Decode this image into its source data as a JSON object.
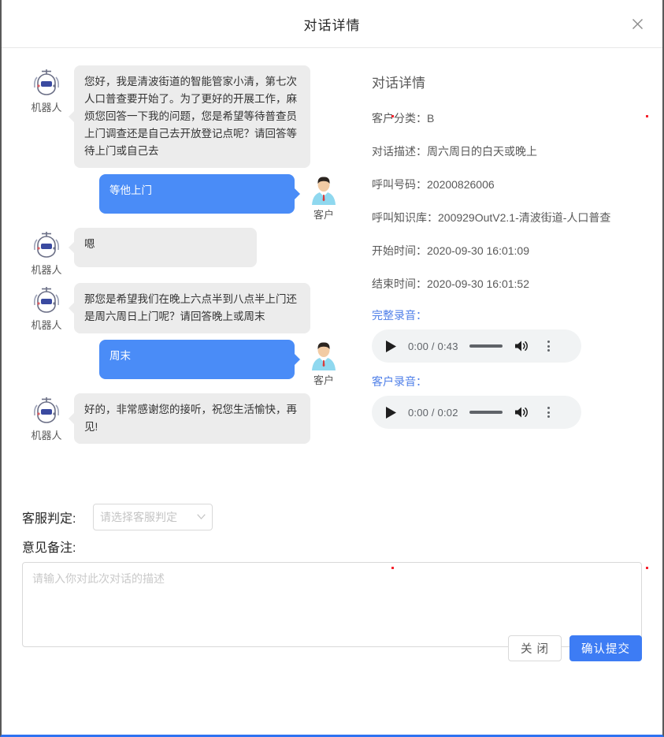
{
  "dialog": {
    "title": "对话详情",
    "close_icon": "close-icon"
  },
  "chat": {
    "bot_label": "机器人",
    "user_label": "客户",
    "messages": [
      {
        "role": "bot",
        "speaker": "机器人",
        "text": "您好，我是清波街道的智能管家小清，第七次人口普查要开始了。为了更好的开展工作，麻烦您回答一下我的问题，您是希望等待普查员上门调查还是自己去开放登记点呢？请回答等待上门或自己去"
      },
      {
        "role": "user",
        "speaker": "客户",
        "text": "等他上门"
      },
      {
        "role": "bot",
        "speaker": "机器人",
        "text": "嗯"
      },
      {
        "role": "bot",
        "speaker": "机器人",
        "text": "那您是希望我们在晚上六点半到八点半上门还是周六周日上门呢？请回答晚上或周末"
      },
      {
        "role": "user",
        "speaker": "客户",
        "text": "周末"
      },
      {
        "role": "bot",
        "speaker": "机器人",
        "text": "好的，非常感谢您的接听，祝您生活愉快，再见!"
      }
    ]
  },
  "details": {
    "heading": "对话详情",
    "fields": [
      {
        "label": "客户分类：",
        "value": "B"
      },
      {
        "label": "对话描述：",
        "value": "周六周日的白天或晚上"
      },
      {
        "label": "呼叫号码：",
        "value": "20200826006"
      },
      {
        "label": "呼叫知识库：",
        "value": "200929OutV2.1-清波街道-人口普查"
      },
      {
        "label": "开始时间：",
        "value": "2020-09-30 16:01:09"
      },
      {
        "label": "结束时间：",
        "value": "2020-09-30 16:01:52"
      }
    ],
    "recordings": [
      {
        "label": "完整录音：",
        "current_time": "0:00",
        "duration": "0:43",
        "time_display": "0:00 / 0:43"
      },
      {
        "label": "客户录音：",
        "current_time": "0:00",
        "duration": "0:02",
        "time_display": "0:00 / 0:02"
      }
    ]
  },
  "form": {
    "judgement_label": "客服判定:",
    "judgement_placeholder": "请选择客服判定",
    "judgement_value": "",
    "notes_label": "意见备注:",
    "notes_placeholder": "请输入你对此次对话的描述",
    "notes_value": ""
  },
  "footer": {
    "close_label": "关 闭",
    "submit_label": "确认提交"
  },
  "colors": {
    "primary": "#3d7cf4",
    "user_bubble": "#4a8cf7",
    "bot_bubble": "#ececec",
    "link": "#4f7fe8",
    "marker": "#f5222d"
  }
}
